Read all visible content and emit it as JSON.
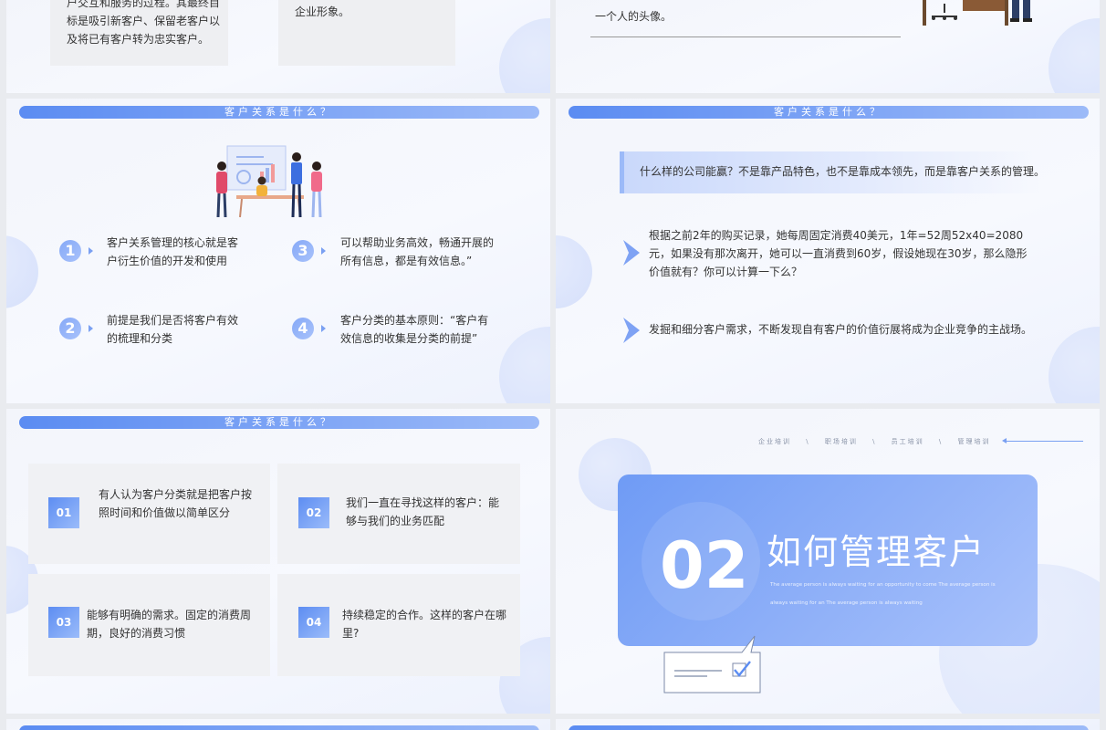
{
  "slide_top_left": {
    "card1_text": "户交互和服务的过程。其最终目标是吸引新客户、保留老客户以及将已有客户转为忠实客户。",
    "card2_text": "企业形象。"
  },
  "slide_top_right": {
    "caption": "一个人的头像。"
  },
  "slide_mid_left": {
    "banner": "客户关系是什么？",
    "items": [
      {
        "num": "1",
        "text": "客户关系管理的核心就是客户衍生价值的开发和使用"
      },
      {
        "num": "2",
        "text": "前提是我们是否将客户有效的梳理和分类"
      },
      {
        "num": "3",
        "text": "可以帮助业务高效，畅通开展的所有信息，都是有效信息。”"
      },
      {
        "num": "4",
        "text": "客户分类的基本原则：“客户有效信息的收集是分类的前提”"
      }
    ]
  },
  "slide_mid_right": {
    "banner": "客户关系是什么？",
    "highlight": "什么样的公司能赢？不是靠产品特色，也不是靠成本领先，而是靠客户关系的管理。",
    "point1": "根据之前2年的购买记录，她每周固定消费40美元，1年=52周52x40=2080元，如果没有那次离开，她可以一直消费到60岁，假设她现在30岁，那么隐形价值就有？你可以计算一下么？",
    "point2": "发掘和细分客户需求，不断发现自有客户的价值衍展将成为企业竞争的主战场。"
  },
  "slide_bot_left": {
    "banner": "客户关系是什么？",
    "cards": [
      {
        "num": "01",
        "text": "有人认为客户分类就是把客户按照时间和价值做以简单区分"
      },
      {
        "num": "02",
        "text": "我们一直在寻找这样的客户：能够与我们的业务匹配"
      },
      {
        "num": "03",
        "text": "能够有明确的需求。固定的消费周期，良好的消费习惯"
      },
      {
        "num": "04",
        "text": "持续稳定的合作。这样的客户在哪里?"
      }
    ]
  },
  "slide_bot_right": {
    "nav": [
      "企业培训",
      "职场培训",
      "员工培训",
      "管理培训"
    ],
    "nav_sep": "\\",
    "number": "02",
    "title": "如何管理客户",
    "subtitle_line1": "The average person is always waiting for an opportunity to come The average person is",
    "subtitle_line2": "always waiting for an The average person is always waiting"
  },
  "colors": {
    "accent": "#5b8cf2",
    "accent_light": "#9cbaf8",
    "card_bg": "#f0f1f4",
    "text": "#333333"
  }
}
